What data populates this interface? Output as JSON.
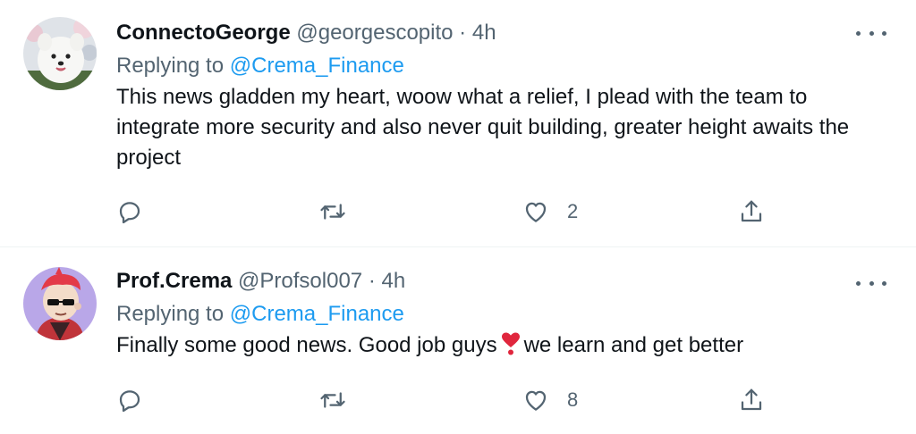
{
  "tweets": [
    {
      "display_name": "ConnectoGeorge",
      "handle": "@georgescopito",
      "separator": "·",
      "time": "4h",
      "replying_prefix": "Replying to",
      "replying_to": "@Crema_Finance",
      "text": "This news gladden my heart, woow what a relief, I plead with the team to integrate more security and also never quit building, greater height awaits the project",
      "likes": "2"
    },
    {
      "display_name": "Prof.Crema",
      "handle": "@Profsol007",
      "separator": "·",
      "time": "4h",
      "replying_prefix": "Replying to",
      "replying_to": "@Crema_Finance",
      "text_before_emoji": "Finally some good news. Good job guys",
      "text_after_emoji": "we learn and get better",
      "likes": "8"
    }
  ],
  "colors": {
    "accent": "#1d9bf0",
    "secondary_text": "#536471",
    "primary_text": "#0f1419",
    "divider": "#eff3f4",
    "heart_emoji": "#e0263d"
  },
  "icons": [
    "more-icon",
    "reply-icon",
    "retweet-icon",
    "like-icon",
    "share-icon",
    "heart-exclamation-emoji"
  ]
}
